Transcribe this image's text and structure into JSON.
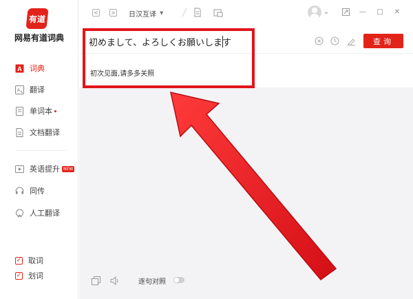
{
  "app": {
    "logo_text": "有道",
    "name": "网易有道词典"
  },
  "sidebar": {
    "items": [
      {
        "label": "词典",
        "icon": "dictionary-icon",
        "active": true
      },
      {
        "label": "翻译",
        "icon": "translate-icon"
      },
      {
        "label": "单词本",
        "icon": "wordbook-icon",
        "dot": true
      },
      {
        "label": "文档翻译",
        "icon": "document-icon"
      },
      {
        "label": "英语提升",
        "icon": "video-icon",
        "badge": "NEW"
      },
      {
        "label": "同传",
        "icon": "interpret-icon"
      },
      {
        "label": "人工翻译",
        "icon": "human-translate-icon"
      }
    ],
    "checks": [
      {
        "label": "取词",
        "checked": true
      },
      {
        "label": "划词",
        "checked": true
      }
    ]
  },
  "toolbar": {
    "back": "<",
    "forward": ">",
    "language": "日汉互译",
    "caret": "▼"
  },
  "window": {
    "minimize": "—",
    "maximize": "□",
    "close": "✕",
    "user_caret": "⌄"
  },
  "search": {
    "value": "初めまして、よろしくお願いします",
    "button": "查询"
  },
  "suggestion": {
    "text": "初次见面,请多多关照"
  },
  "bottom": {
    "toggle_label": "逐句对照"
  },
  "colors": {
    "brand": "#e2231a",
    "annotation": "#e2141b"
  }
}
